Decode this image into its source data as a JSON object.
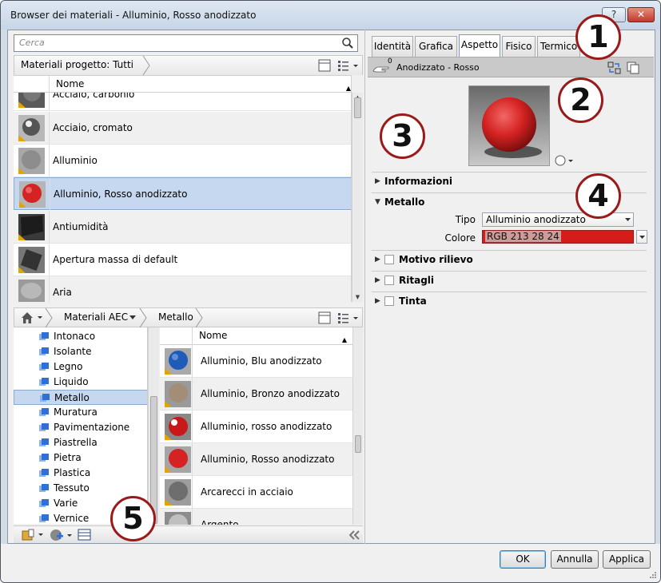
{
  "window": {
    "title": "Browser dei materiali - Alluminio, Rosso anodizzato",
    "help": "?",
    "close": "✕"
  },
  "search": {
    "placeholder": "Cerca"
  },
  "project_library": {
    "label": "Materiali progetto: Tutti",
    "column_name": "Nome",
    "materials": [
      {
        "name": "Acciaio, carbonio",
        "swatch": "#6d6d6d"
      },
      {
        "name": "Acciaio, cromato",
        "swatch": "#9a9a9a"
      },
      {
        "name": "Alluminio",
        "swatch": "#8a8a8a"
      },
      {
        "name": "Alluminio, Rosso anodizzato",
        "swatch": "#d52222",
        "selected": true
      },
      {
        "name": "Antiumidità",
        "swatch": "#2a2a2a"
      },
      {
        "name": "Apertura massa di default",
        "swatch": "#555555"
      },
      {
        "name": "Aria",
        "swatch": "#b5b5b5"
      }
    ]
  },
  "library_browser": {
    "breadcrumb": [
      "Materiali AEC",
      "Metallo"
    ],
    "categories": [
      "Intonaco",
      "Isolante",
      "Legno",
      "Liquido",
      "Metallo",
      "Muratura",
      "Pavimentazione",
      "Piastrella",
      "Pietra",
      "Plastica",
      "Tessuto",
      "Varie",
      "Vernice"
    ],
    "selected_category": "Metallo",
    "column_name": "Nome",
    "materials": [
      {
        "name": "Alluminio, Blu anodizzato",
        "swatch": "#1f5bb8"
      },
      {
        "name": "Alluminio, Bronzo anodizzato",
        "swatch": "#a28d78"
      },
      {
        "name": "Alluminio, rosso anodizzato",
        "swatch": "#c81818"
      },
      {
        "name": "Alluminio, Rosso anodizzato",
        "swatch": "#d52222"
      },
      {
        "name": "Arcarecci in acciaio",
        "swatch": "#7a7a7a"
      },
      {
        "name": "Argento",
        "swatch": "#c0c0c0"
      }
    ]
  },
  "tabs": [
    "Identità",
    "Grafica",
    "Aspetto",
    "Fisico",
    "Termico"
  ],
  "active_tab": "Aspetto",
  "asset": {
    "name": "Anodizzato - Rosso",
    "count": "0"
  },
  "properties": {
    "sections": [
      "Informazioni",
      "Metallo",
      "Motivo rilievo",
      "Ritagli",
      "Tinta"
    ],
    "tipo_label": "Tipo",
    "tipo_value": "Alluminio anodizzato",
    "colore_label": "Colore",
    "colore_value": "RGB 213 28 24",
    "color_hex": "#d51c18"
  },
  "footer": {
    "ok": "OK",
    "cancel": "Annulla",
    "apply": "Applica"
  },
  "callouts": [
    "1",
    "2",
    "3",
    "4",
    "5"
  ],
  "colors": {
    "selection": "#c5d8ef",
    "accent_red": "#9a1a1a",
    "folder_blue": "#2f6fd6"
  }
}
